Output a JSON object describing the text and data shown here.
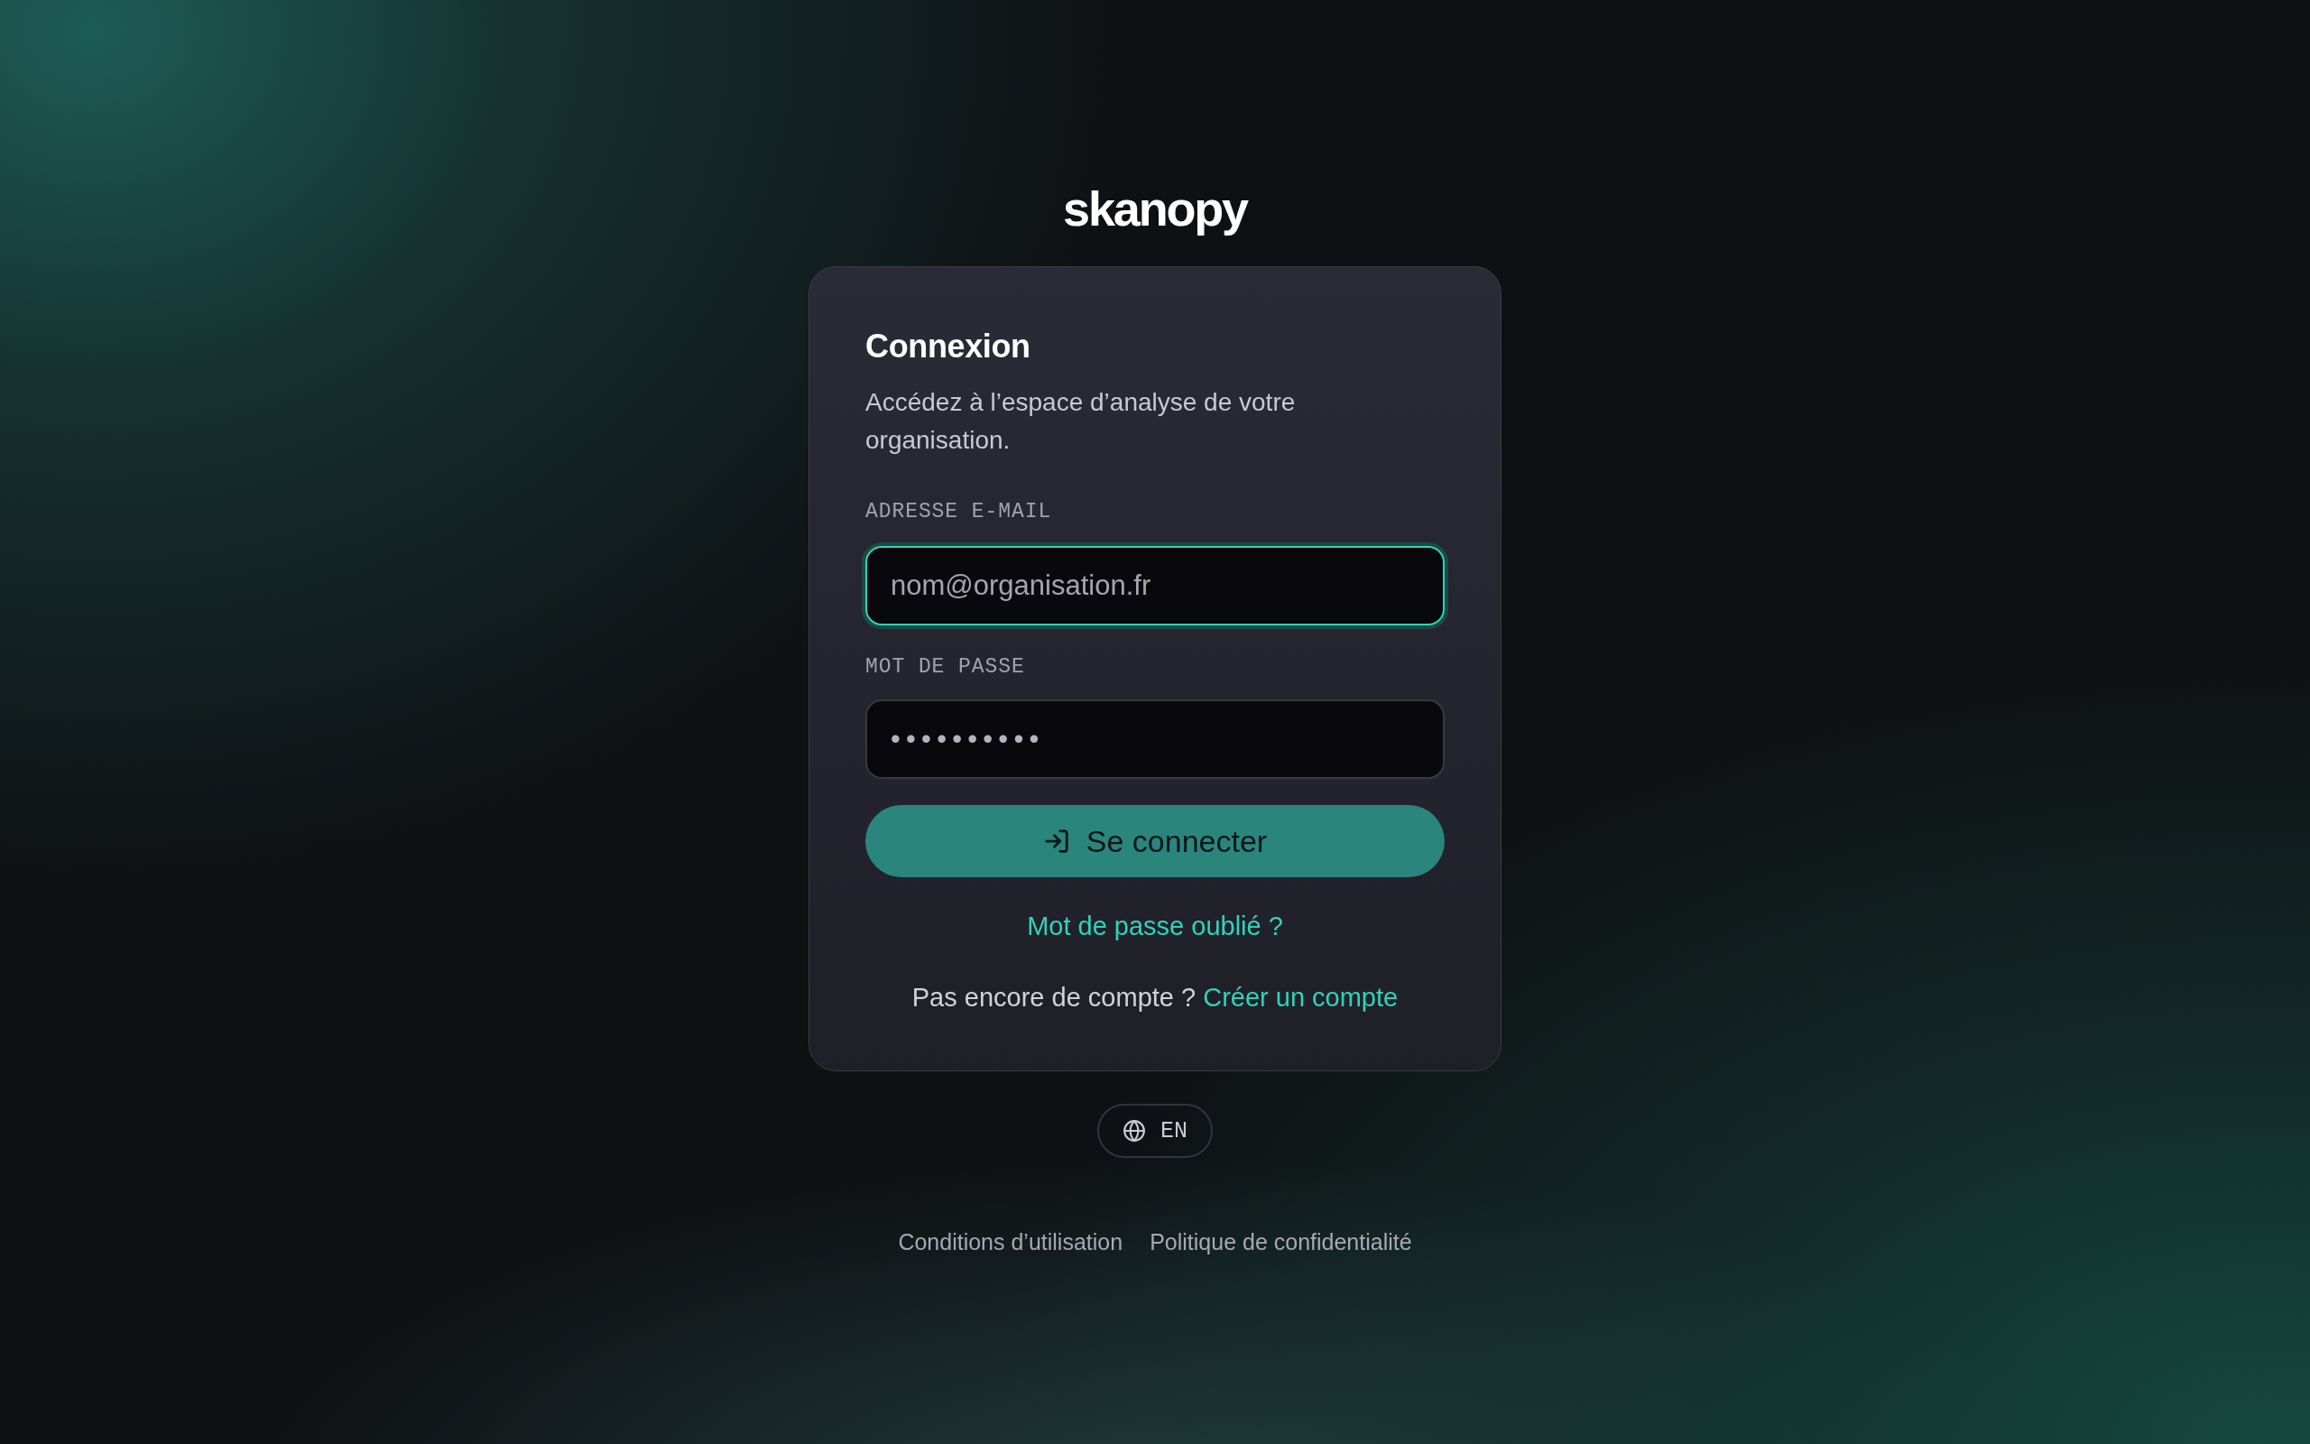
{
  "logo": {
    "text": "skanopy"
  },
  "card": {
    "title": "Connexion",
    "subtitle": "Accédez à l’espace d’analyse de votre organisation.",
    "fields": [
      {
        "label": "ADRESSE E-MAIL",
        "placeholder": "nom@organisation.fr",
        "focused": true
      },
      {
        "label": "MOT DE PASSE",
        "value": "••••••••••",
        "focused": false
      }
    ],
    "submit_button": {
      "label": "Se connecter"
    },
    "forgot_link": "Mot de passe oublié ?",
    "signup": {
      "prompt": "Pas encore de compte ?",
      "link": "Créer un compte"
    }
  },
  "language_button": {
    "label": "EN"
  },
  "footer_links": [
    "Conditions d’utilisation",
    "Politique de confidentialité"
  ]
}
